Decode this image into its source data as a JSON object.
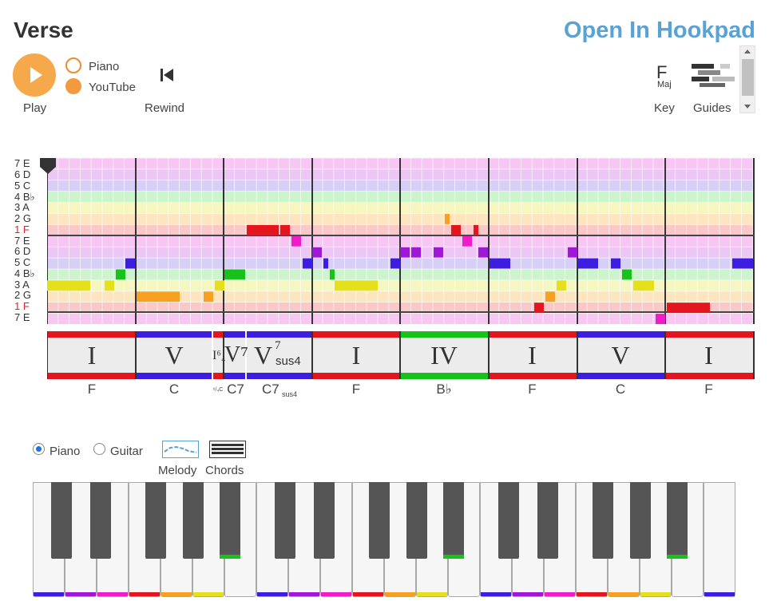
{
  "header": {
    "title": "Verse",
    "open_link": "Open In Hookpad"
  },
  "controls": {
    "play_label": "Play",
    "sound_options": [
      {
        "label": "Piano",
        "selected": false
      },
      {
        "label": "YouTube",
        "selected": true
      }
    ],
    "rewind_label": "Rewind",
    "key": {
      "tonic": "F",
      "mode": "Maj",
      "label": "Key"
    },
    "guides_label": "Guides"
  },
  "piano_roll": {
    "row_labels": [
      "7 E",
      "6 D",
      "5 C",
      "4 B♭",
      "3 A",
      "2 G",
      "1 F",
      "7 E",
      "6 D",
      "5 C",
      "4 B♭",
      "3 A",
      "2 G",
      "1 F",
      "7 E"
    ],
    "tonic_color": "#e0202a"
  },
  "chords": [
    {
      "roman": "I",
      "name": "F"
    },
    {
      "roman": "V",
      "name": "C"
    },
    {
      "roman": "I⁶₄",
      "name": "⁶/₄C"
    },
    {
      "roman": "V⁷",
      "name": "C7"
    },
    {
      "roman": "V",
      "roman_sup": "7",
      "roman_sub": "sus4",
      "name": "C7",
      "name_sub": "sus4"
    },
    {
      "roman": "I",
      "name": "F"
    },
    {
      "roman": "IV",
      "name": "B♭"
    },
    {
      "roman": "I",
      "name": "F"
    },
    {
      "roman": "V",
      "name": "C"
    },
    {
      "roman": "I",
      "name": "F"
    }
  ],
  "instrument": {
    "options": [
      {
        "label": "Piano",
        "selected": true
      },
      {
        "label": "Guitar",
        "selected": false
      }
    ],
    "view_labels": [
      "Melody",
      "Chords"
    ]
  },
  "colors": {
    "degree1": "#e4151f",
    "degree2": "#f7a021",
    "degree3": "#e6e01c",
    "degree4": "#17c21a",
    "degree5": "#3d1ee0",
    "degree6": "#9f18d6",
    "degree7": "#f01cc9",
    "accent_blue": "#5aa2d4",
    "play_orange": "#f5a94a"
  }
}
